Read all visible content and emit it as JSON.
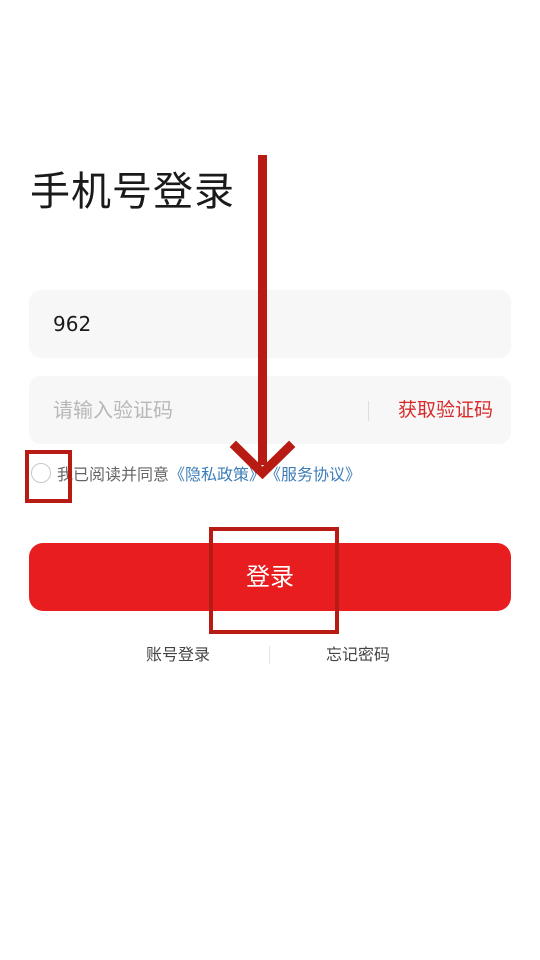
{
  "header": {
    "title": "手机号登录"
  },
  "phone": {
    "value": "962"
  },
  "code": {
    "value": "",
    "placeholder": "请输入验证码",
    "get_code_label": "获取验证码"
  },
  "agreement": {
    "checked": false,
    "prefix": "我已阅读并同意",
    "privacy_link": "《隐私政策》",
    "service_link": "《服务协议》"
  },
  "login_button": {
    "label": "登录"
  },
  "footer": {
    "account_login": "账号登录",
    "forgot_password": "忘记密码"
  },
  "colors": {
    "primary": "#e81d1f",
    "link": "#3d7db8",
    "get_code": "#d82a2a",
    "annotation": "#b81b14",
    "input_background": "#f7f7f7"
  },
  "annotations": {
    "arrow_icon": "arrow-down-icon",
    "highlights": [
      "agree-checkbox",
      "login-button"
    ]
  }
}
